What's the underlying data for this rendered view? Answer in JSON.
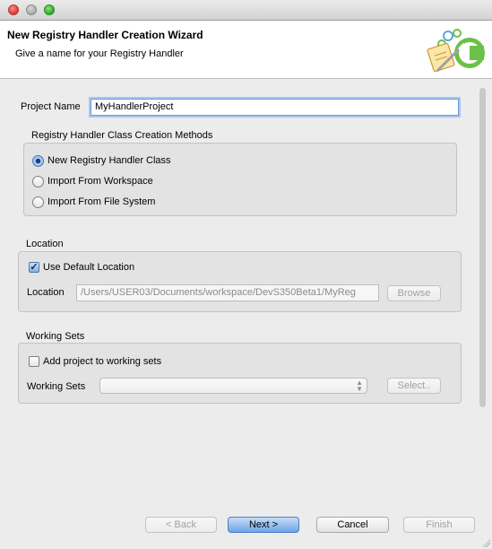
{
  "window": {
    "controls": [
      "close",
      "minimize",
      "maximize"
    ]
  },
  "banner": {
    "title": "New Registry Handler Creation Wizard",
    "subtitle": "Give a name for your Registry Handler",
    "logo_icon": "wizard-logo-icon"
  },
  "project": {
    "label": "Project Name",
    "value": "MyHandlerProject"
  },
  "methods": {
    "title": "Registry Handler Class Creation Methods",
    "options": [
      {
        "label": "New Registry Handler Class",
        "selected": true
      },
      {
        "label": "Import From Workspace",
        "selected": false
      },
      {
        "label": "Import From File System",
        "selected": false
      }
    ]
  },
  "location": {
    "title": "Location",
    "use_default_label": "Use Default Location",
    "use_default_checked": true,
    "field_label": "Location",
    "path": "/Users/USER03/Documents/workspace/DevS350Beta1/MyReg",
    "browse_label": "Browse"
  },
  "working_sets": {
    "title": "Working Sets",
    "add_label": "Add project to working sets",
    "add_checked": false,
    "field_label": "Working Sets",
    "value": "",
    "select_label": "Select.."
  },
  "buttons": {
    "back": "< Back",
    "next": "Next >",
    "cancel": "Cancel",
    "finish": "Finish"
  },
  "colors": {
    "accent": "#6ea4e8",
    "focus_ring": "#a9c7ee"
  }
}
